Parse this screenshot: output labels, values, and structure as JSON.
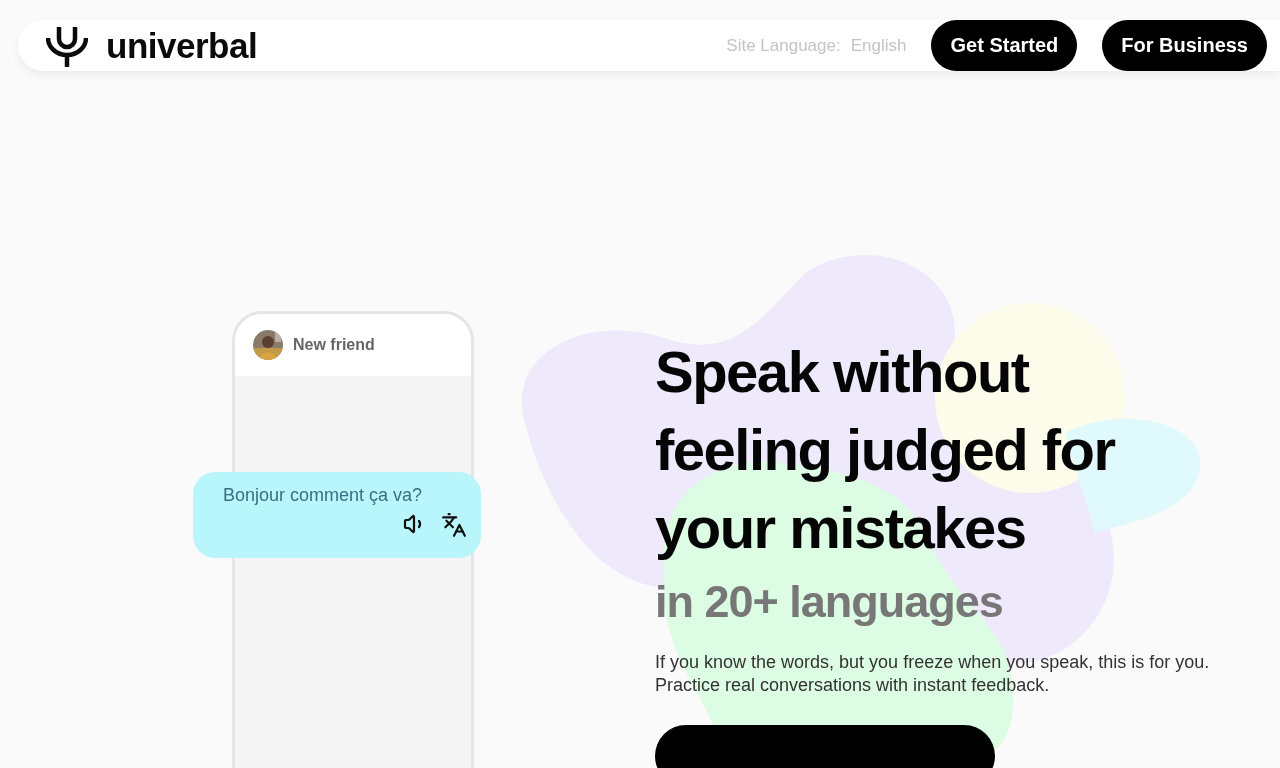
{
  "nav": {
    "brand": "univerbal",
    "language_label": "Site Language:",
    "language_value": "English",
    "buttons": [
      "Get Started",
      "For Business"
    ]
  },
  "chat": {
    "contact": "New friend",
    "message": "Bonjour comment ça va?"
  },
  "hero": {
    "heading": "Speak without feeling judged for your mistakes",
    "subheading": "in 20+ languages",
    "description": "If you know the words, but you freeze when you speak, this is for you. Practice real conversations with instant feedback."
  }
}
